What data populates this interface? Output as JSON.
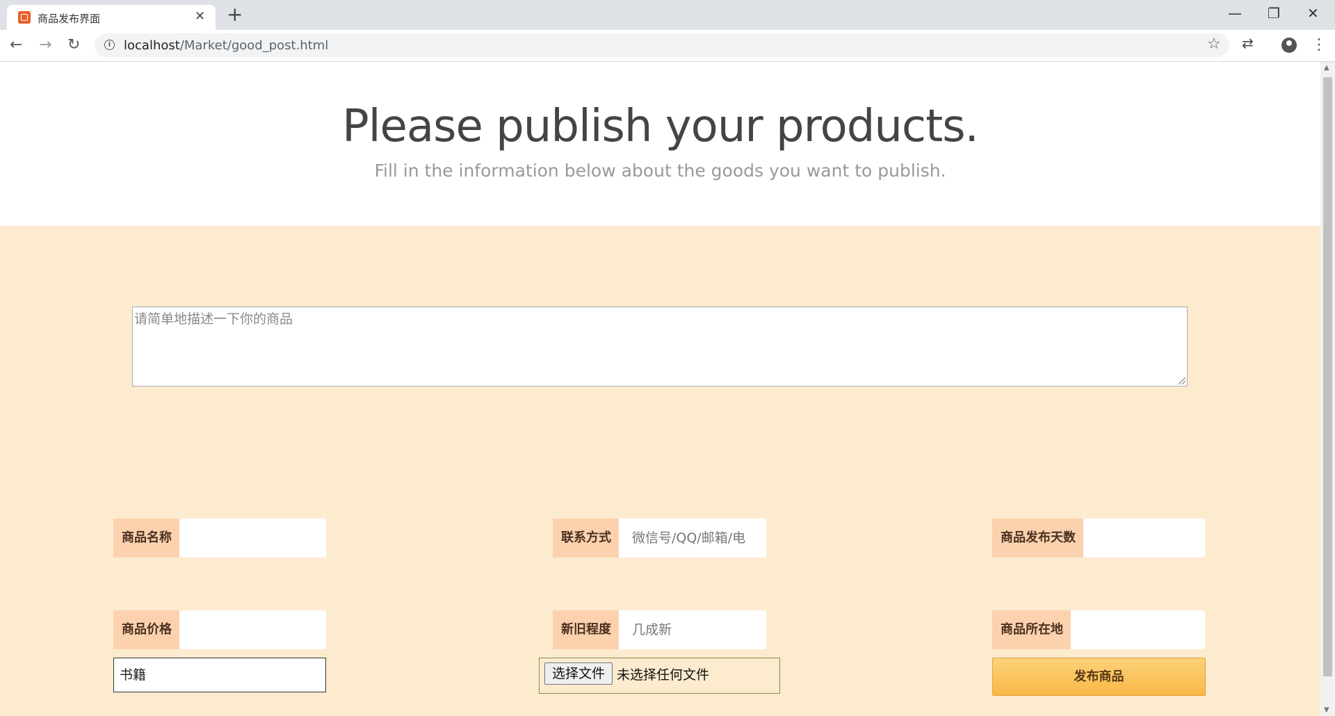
{
  "browser": {
    "tab_title": "商品发布界面",
    "tab_close": "✕",
    "new_tab": "+",
    "url_host": "localhost",
    "url_path": "/Market/good_post.html"
  },
  "icons": {
    "back": "←",
    "forward": "→",
    "reload": "↻",
    "star": "☆",
    "extension": "⇄",
    "menu": "⋮",
    "minimize": "—",
    "restore": "❐",
    "close": "✕",
    "scroll_up": "▲",
    "scroll_down": "▼",
    "info": "i"
  },
  "hero": {
    "title": "Please publish your products.",
    "subtitle": "Fill in the information below about the goods you want to publish."
  },
  "form": {
    "description_placeholder": "请简单地描述一下你的商品",
    "fields": {
      "name_label": "商品名称",
      "contact_label": "联系方式",
      "contact_placeholder": "微信号/QQ/邮箱/电",
      "days_label": "商品发布天数",
      "price_label": "商品价格",
      "condition_label": "新旧程度",
      "condition_placeholder": "几成新",
      "location_label": "商品所在地"
    },
    "category_selected": "书籍",
    "file_button": "选择文件",
    "file_status": "未选择任何文件",
    "submit_label": "发布商品"
  }
}
